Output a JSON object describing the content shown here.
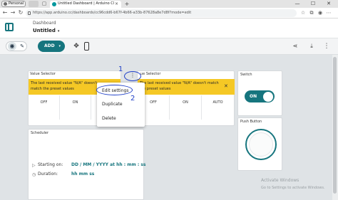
{
  "browser": {
    "profile": "Personal",
    "tab_title": "Untitled Dashboard | Arduino Cl",
    "tab_close": "×",
    "new_tab": "+",
    "url": "https://app.arduino.cc/dashboards/cc96cdd6-b67f-4b66-a33b-87628a8e7d8f?mode=edit",
    "window_controls": {
      "min": "—",
      "max": "☐",
      "close": "✕"
    }
  },
  "header": {
    "breadcrumb": "Dashboard",
    "title": "Untitled",
    "title_chevron": "▾"
  },
  "toolbar": {
    "add_label": "ADD",
    "add_chevron": "▾"
  },
  "widgets": {
    "value_selector_1": {
      "title": "Value Selector",
      "warning": "The last received value \"N/A\" doesn't match the preset values",
      "options": [
        "OFF",
        "ON"
      ]
    },
    "value_selector_2": {
      "title_fragment": "ue Selector",
      "warning": "The last received value \"N/A\" doesn't match the preset values",
      "close": "✕",
      "options": [
        "OFF",
        "ON",
        "AUTO"
      ]
    },
    "switch": {
      "title": "Switch",
      "state": "ON"
    },
    "push_button": {
      "title": "Push Button"
    },
    "scheduler": {
      "title": "Scheduler",
      "starting_label": "Starting on:",
      "starting_value": "DD / MM / YYYY at hh : mm : ss",
      "duration_label": "Duration:",
      "duration_value": "hh mm ss"
    }
  },
  "context_menu": {
    "trigger": "⋮",
    "items": [
      "Edit settings",
      "Duplicate",
      "Delete"
    ]
  },
  "annotations": {
    "one": "1",
    "two": "2",
    "color": "#1f3fc7"
  },
  "watermark": {
    "line1": "Activate Windows",
    "line2": "Go to Settings to activate Windows."
  },
  "colors": {
    "accent": "#16757e",
    "warning": "#f5c825"
  }
}
